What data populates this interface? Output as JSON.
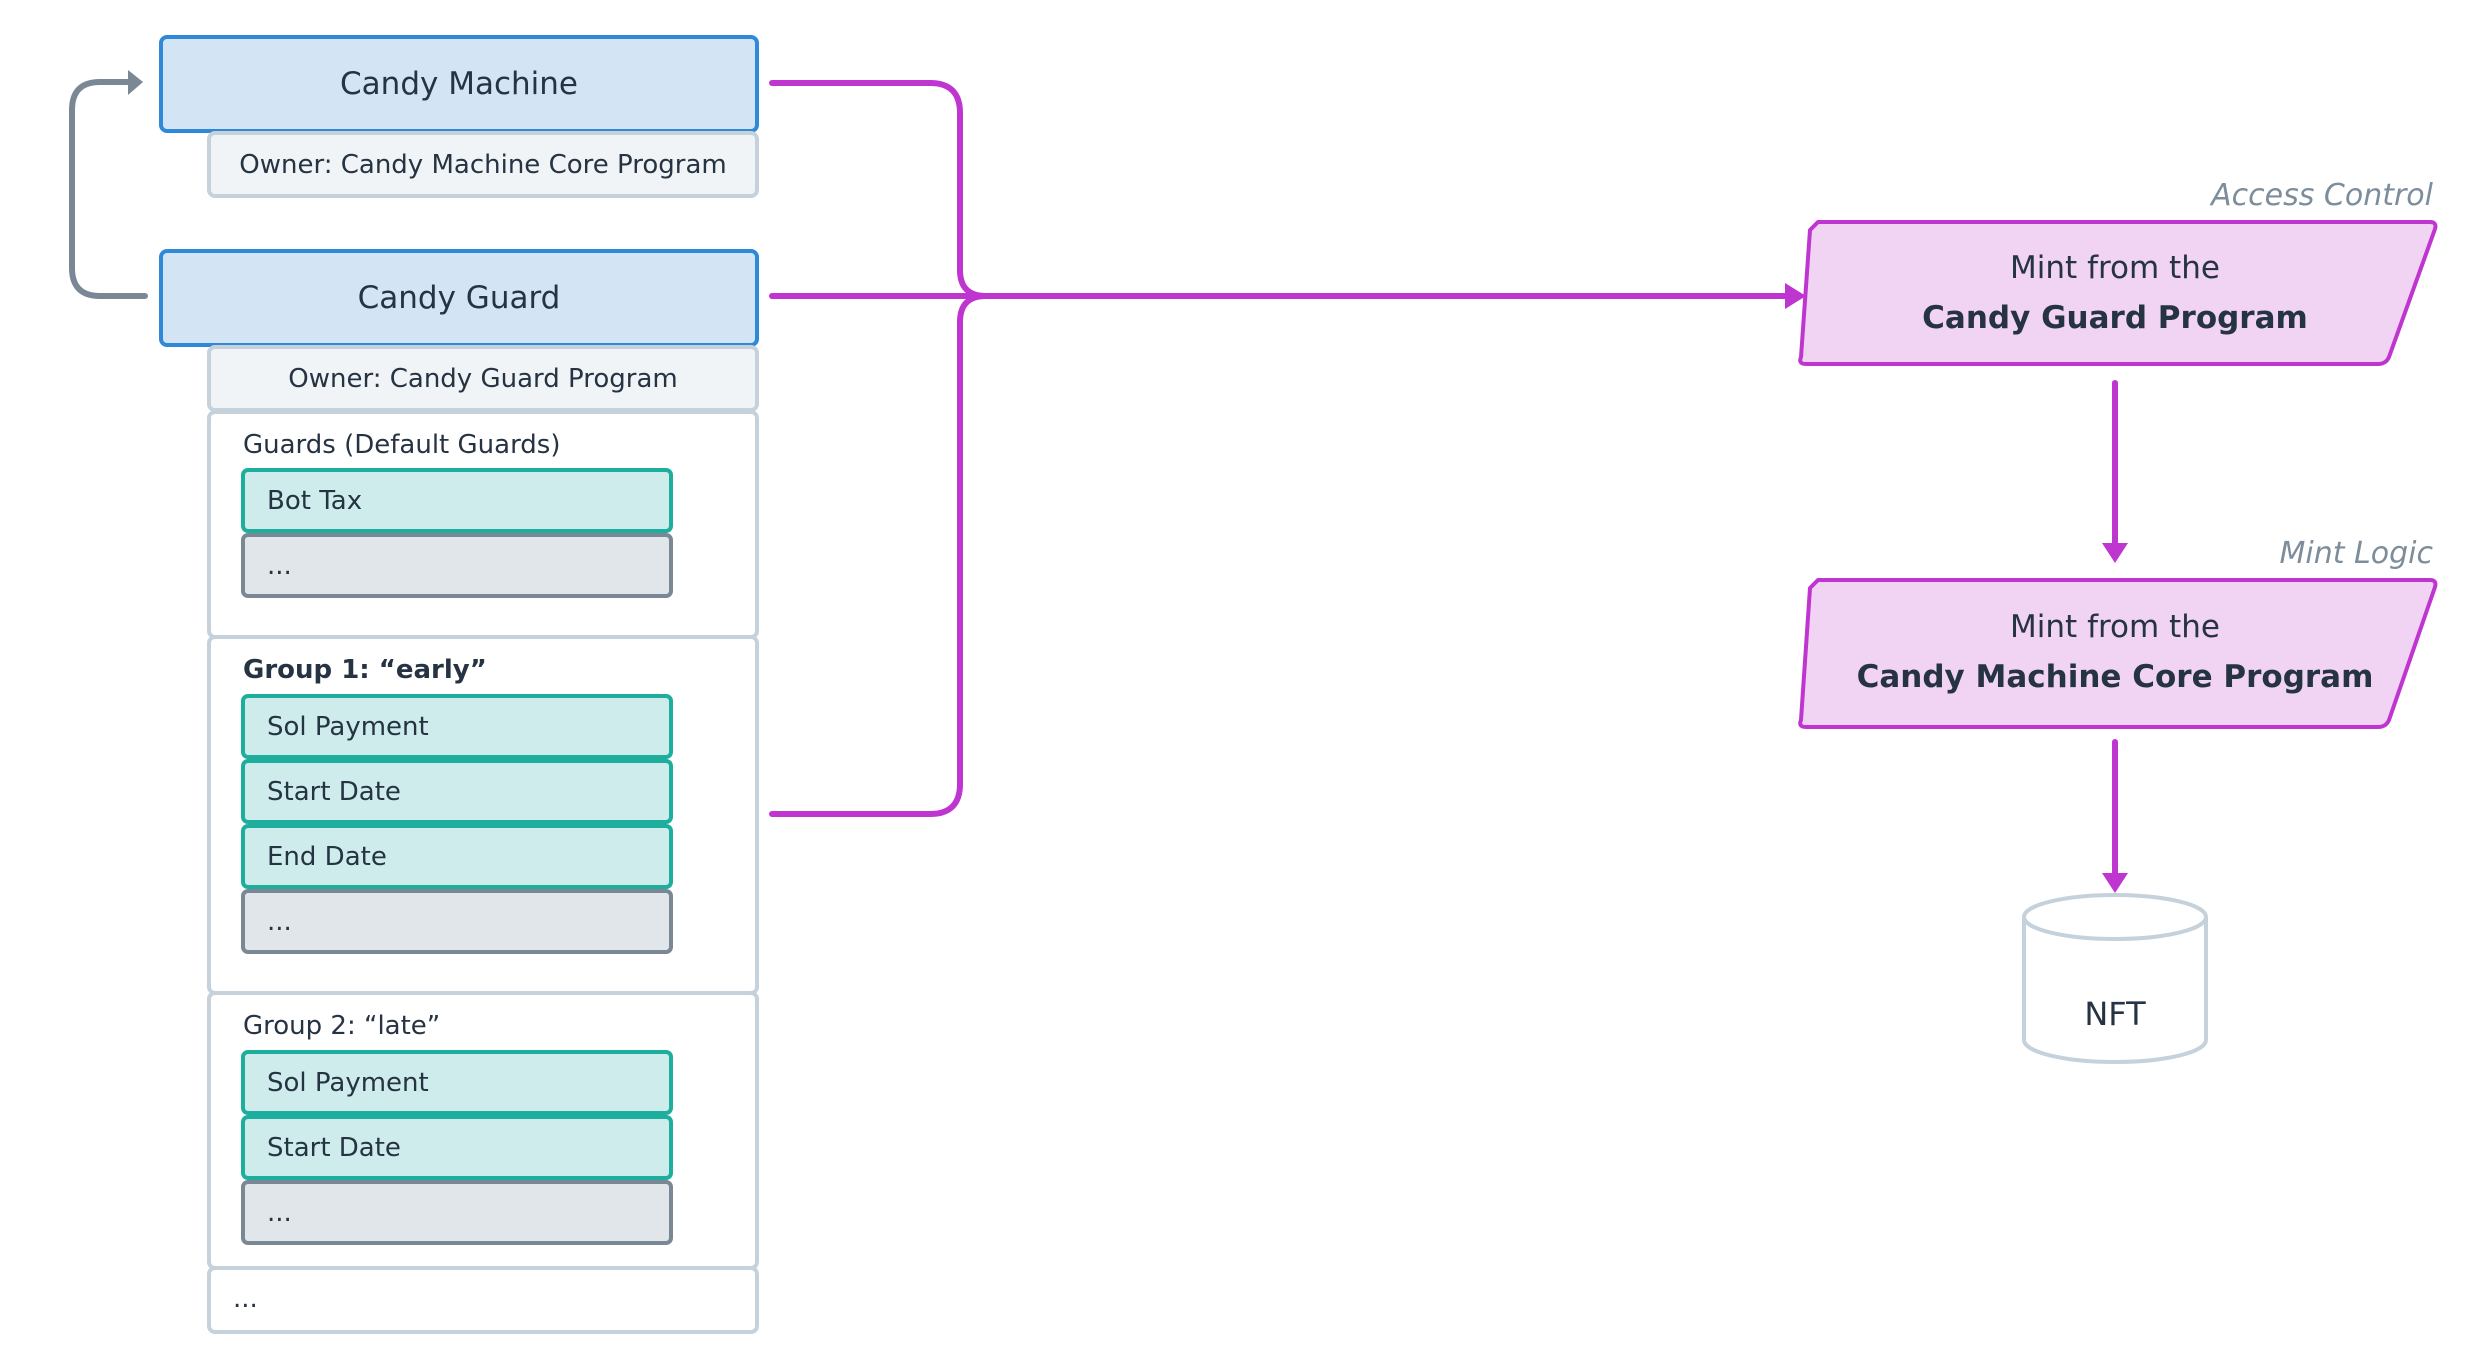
{
  "accounts": {
    "candy_machine": {
      "title": "Candy Machine",
      "owner": "Owner: Candy Machine Core Program"
    },
    "candy_guard": {
      "title": "Candy Guard",
      "owner": "Owner: Candy Guard Program"
    }
  },
  "guard_sections": [
    {
      "label": "Guards (Default Guards)",
      "bold": false,
      "items": [
        "Bot Tax",
        "..."
      ]
    },
    {
      "label": "Group 1: “early”",
      "bold": true,
      "items": [
        "Sol Payment",
        "Start Date",
        "End Date",
        "..."
      ]
    },
    {
      "label": "Group 2: “late”",
      "bold": false,
      "items": [
        "Sol Payment",
        "Start Date",
        "..."
      ]
    }
  ],
  "trailing_section": "...",
  "steps": [
    {
      "tag": "Access Control",
      "line1": "Mint from the",
      "line2": "Candy Guard Program"
    },
    {
      "tag": "Mint Logic",
      "line1": "Mint from the",
      "line2": "Candy Machine Core Program"
    }
  ],
  "output": {
    "label": "NFT"
  },
  "colors": {
    "account_fill": "#d3e5f5",
    "account_border": "#2f88d8",
    "guard_fill": "#ceecec",
    "guard_border": "#1eae9d",
    "flow_line": "#bf35d0",
    "step_fill": "#f1d3f3",
    "loop_arrow": "#7a8896"
  }
}
